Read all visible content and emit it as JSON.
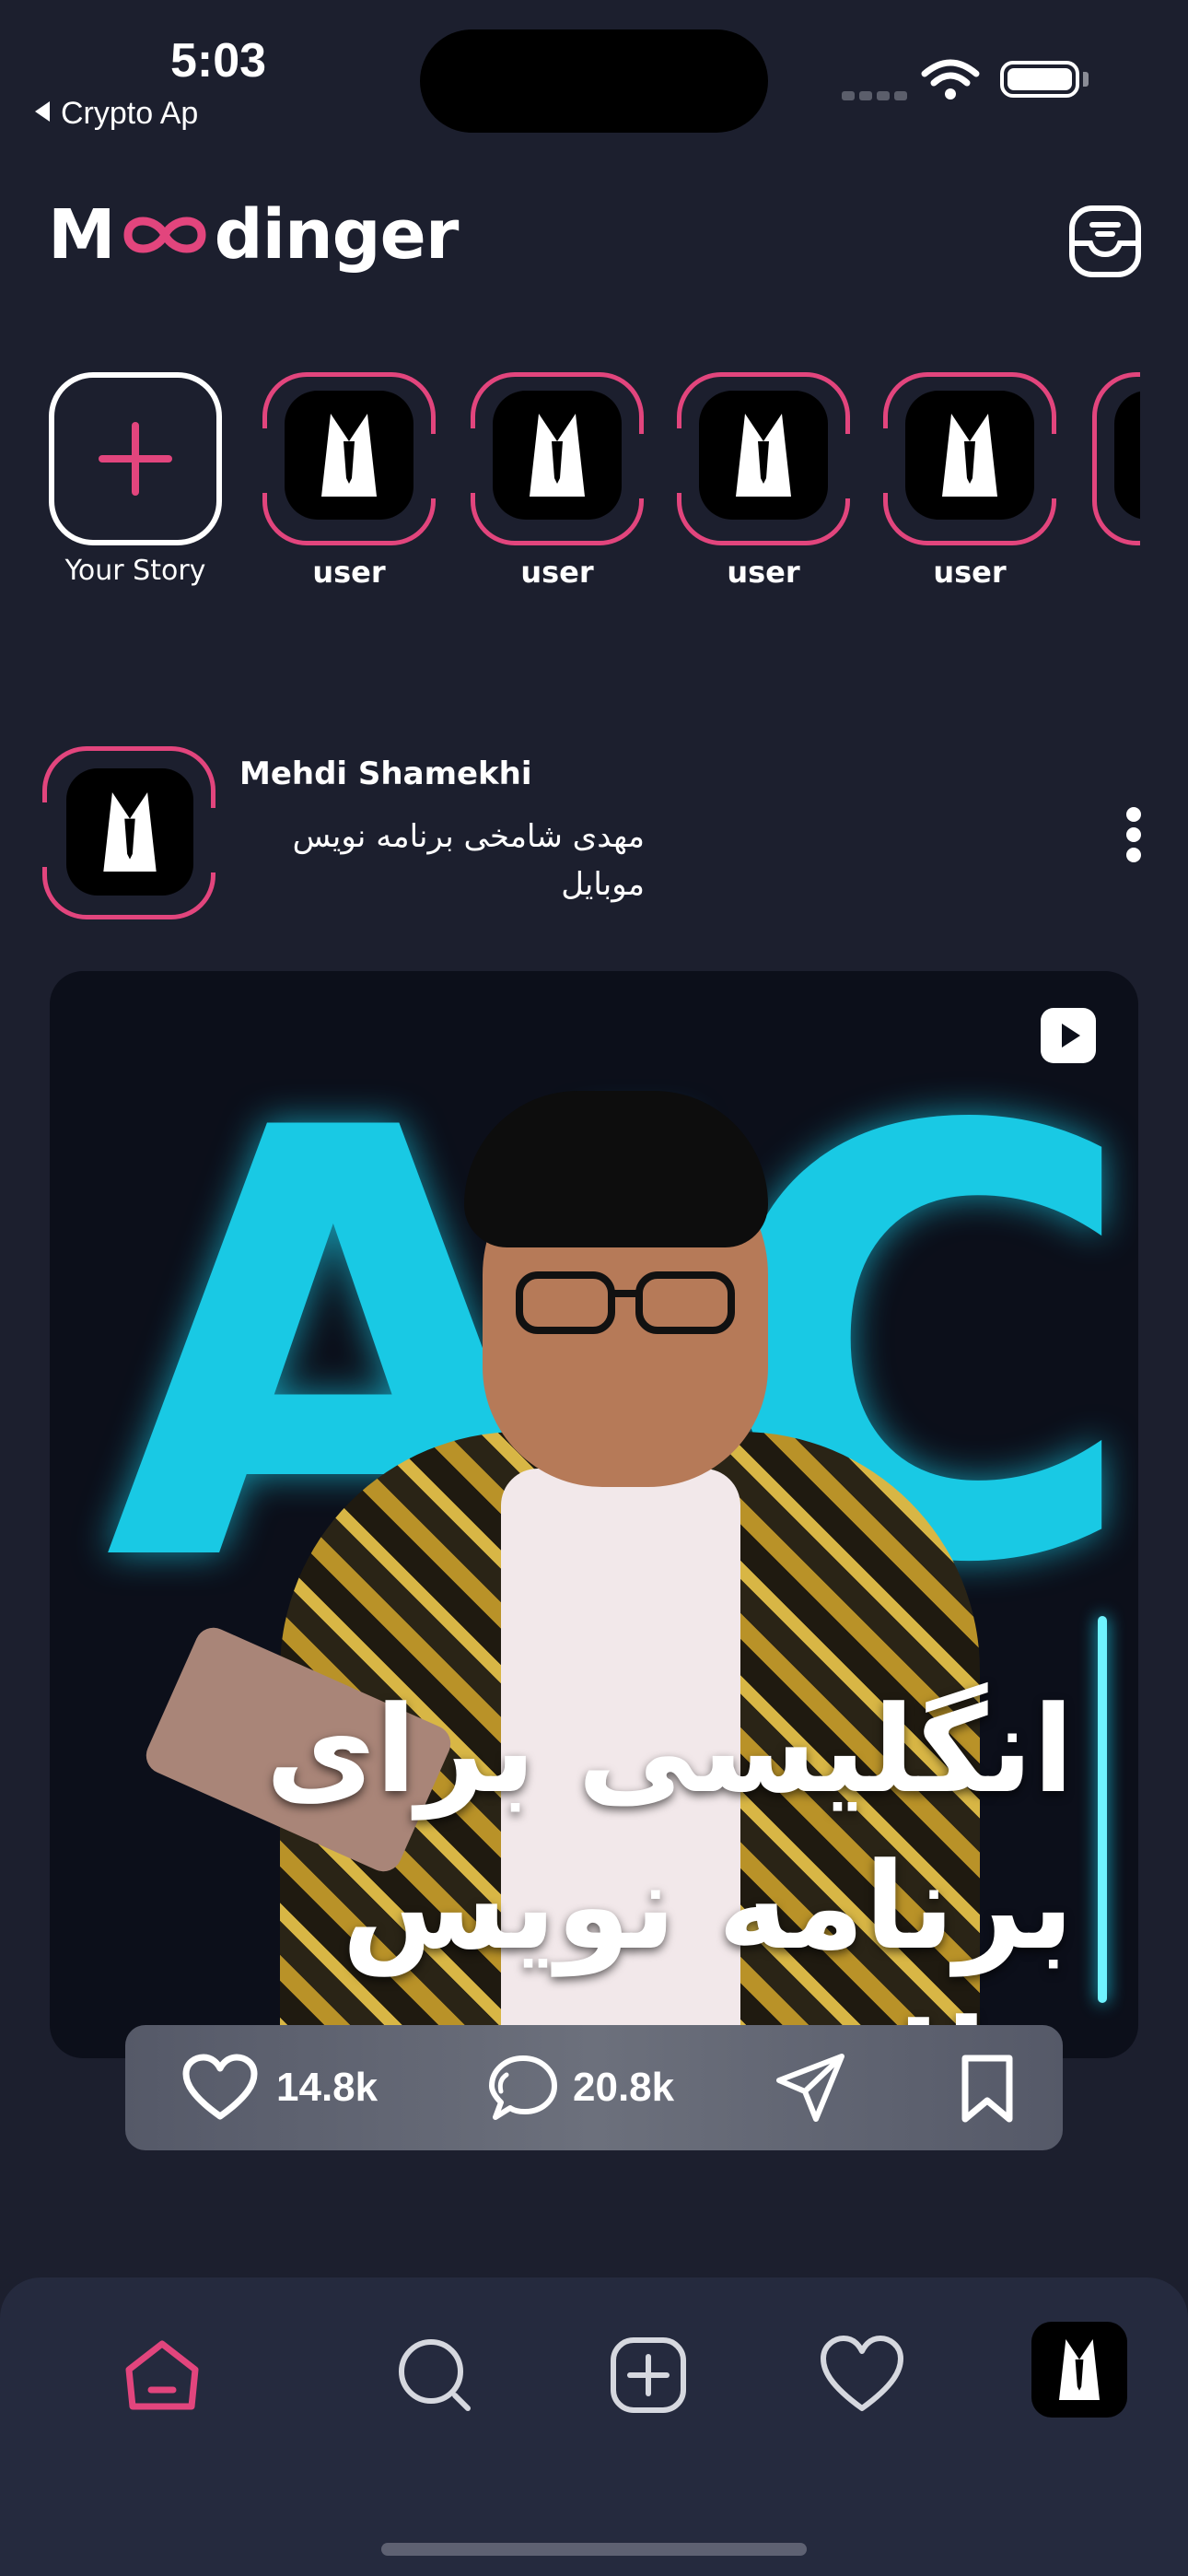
{
  "status_bar": {
    "time": "5:03",
    "back_label": "Crypto Ap"
  },
  "header": {
    "logo_prefix": "M",
    "logo_suffix": "dinger",
    "accent_color": "#e2457d"
  },
  "stories": {
    "add_label": "Your Story",
    "items": [
      {
        "label": "user"
      },
      {
        "label": "user"
      },
      {
        "label": "user"
      },
      {
        "label": "user"
      }
    ]
  },
  "post": {
    "username": "Mehdi Shamekhi",
    "subtitle": "مهدی شامخی برنامه نویس موبایل",
    "media_letters": "AIC",
    "media_caption": "انگلیسی برای برنامه نویس ها!",
    "likes": "14.8k",
    "comments": "20.8k"
  },
  "tabbar": {
    "items": [
      "home-icon",
      "search-icon",
      "add-icon",
      "heart-icon",
      "profile-avatar"
    ]
  }
}
